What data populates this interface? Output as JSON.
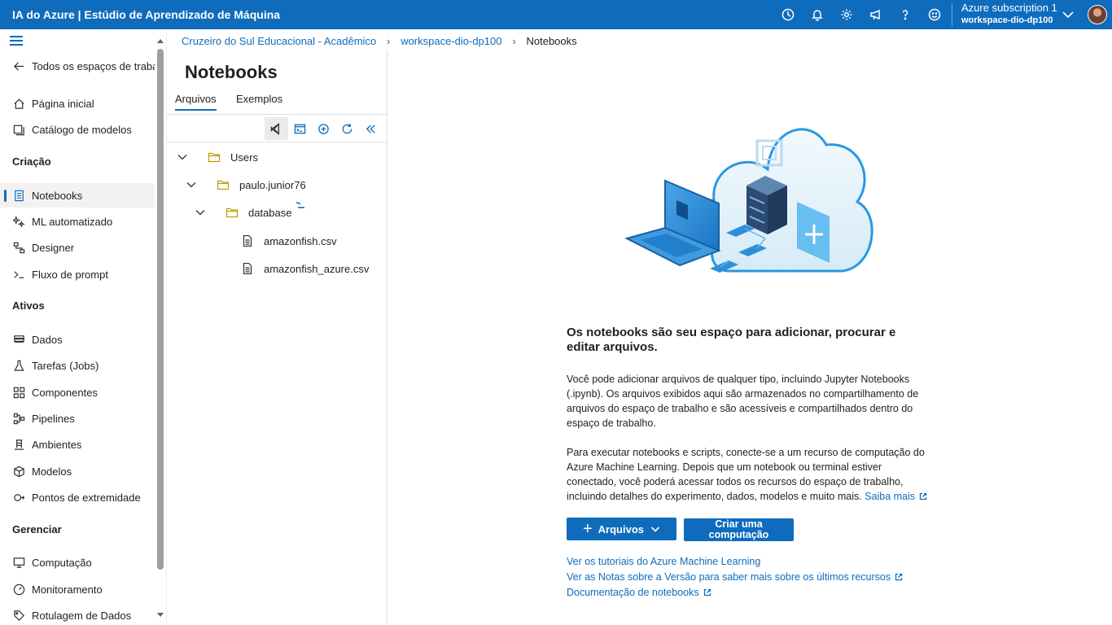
{
  "topbar": {
    "title": "IA do Azure | Estúdio de Aprendizado de Máquina",
    "icons": [
      "clock-icon",
      "bell-icon",
      "gear-icon",
      "megaphone-icon",
      "help-icon",
      "smiley-icon"
    ],
    "account": {
      "subscription": "Azure subscription 1",
      "workspace": "workspace-dio-dp100"
    },
    "colors": {
      "brand": "#0f6cbd"
    }
  },
  "nav": {
    "back_label": "Todos os espaços de trabal",
    "home": "Página inicial",
    "model_catalog": "Catálogo de modelos",
    "section_create": "Criação",
    "notebooks": "Notebooks",
    "automl": "ML automatizado",
    "designer": "Designer",
    "promptflow": "Fluxo de prompt",
    "section_assets": "Ativos",
    "data": "Dados",
    "jobs": "Tarefas (Jobs)",
    "components": "Componentes",
    "pipelines": "Pipelines",
    "environments": "Ambientes",
    "models": "Modelos",
    "endpoints": "Pontos de extremidade",
    "section_manage": "Gerenciar",
    "compute": "Computação",
    "monitoring": "Monitoramento",
    "labeling": "Rotulagem de Dados"
  },
  "breadcrumb": {
    "org": "Cruzeiro do Sul Educacional - Acadêmico",
    "workspace": "workspace-dio-dp100",
    "current": "Notebooks"
  },
  "panel": {
    "title": "Notebooks",
    "tabs": {
      "files": "Arquivos",
      "samples": "Exemplos"
    },
    "tree": {
      "users": "Users",
      "user": "paulo.junior76",
      "folder": "database",
      "file1": "amazonfish.csv",
      "file2": "amazonfish_azure.csv"
    }
  },
  "main": {
    "empty_title": "Os notebooks são seu espaço para adicionar, procurar e editar arquivos.",
    "para1": "Você pode adicionar arquivos de qualquer tipo, incluindo Jupyter Notebooks (.ipynb). Os arquivos exibidos aqui são armazenados no compartilhamento de arquivos do espaço de trabalho e são acessíveis e compartilhados dentro do espaço de trabalho.",
    "para2": "Para executar notebooks e scripts, conecte-se a um recurso de computação do Azure Machine Learning. Depois que um notebook ou terminal estiver conectado, você poderá acessar todos os recursos do espaço de trabalho, incluindo detalhes do experimento, dados, modelos e muito mais.",
    "learn_more": "Saiba mais",
    "files_button": "Arquivos",
    "compute_button": "Criar uma computação",
    "link_tutorials": "Ver os tutoriais do Azure Machine Learning",
    "link_release_notes": "Ver as Notas sobre a Versão para saber mais sobre os últimos recursos",
    "link_docs": "Documentação de notebooks"
  }
}
